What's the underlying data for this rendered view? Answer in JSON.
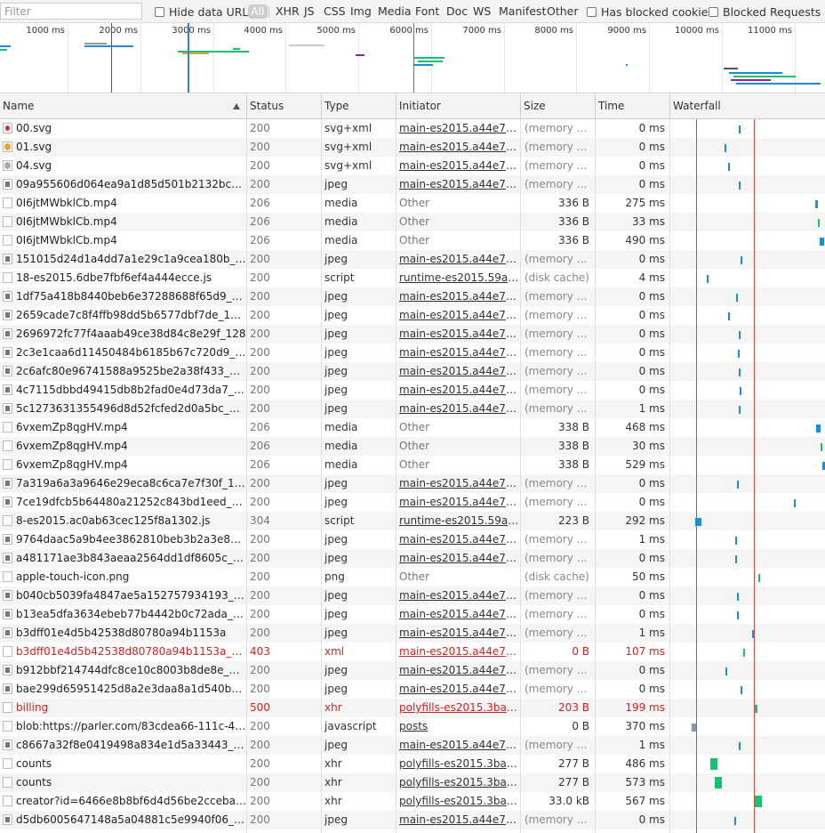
{
  "filter": {
    "placeholder": "Filter"
  },
  "toolbar": {
    "hide_data_urls": "Hide data URLs",
    "types": [
      "All",
      "XHR",
      "JS",
      "CSS",
      "Img",
      "Media",
      "Font",
      "Doc",
      "WS",
      "Manifest",
      "Other"
    ],
    "has_blocked_cookies": "Has blocked cookies",
    "blocked_requests": "Blocked Requests"
  },
  "overview": {
    "ticks": [
      "1000 ms",
      "2000 ms",
      "3000 ms",
      "4000 ms",
      "5000 ms",
      "6000 ms",
      "7000 ms",
      "8000 ms",
      "9000 ms",
      "10000 ms",
      "11000 ms"
    ]
  },
  "columns": {
    "name": "Name",
    "status": "Status",
    "type": "Type",
    "initiator": "Initiator",
    "size": "Size",
    "time": "Time",
    "waterfall": "Waterfall"
  },
  "colors": {
    "blue_line": "#3b7bd6",
    "red_line": "#dd4444",
    "bar_blue": "#1f8dd6",
    "bar_green": "#18c16e",
    "error_text": "#d42222"
  },
  "rows": [
    {
      "name": "00.svg",
      "status": "200",
      "type": "svg+xml",
      "initiator": "main-es2015.a44e72b...",
      "size": "(memory ca...",
      "time": "0 ms",
      "icon": "red-icon"
    },
    {
      "name": "01.svg",
      "status": "200",
      "type": "svg+xml",
      "initiator": "main-es2015.a44e72b...",
      "size": "(memory ca...",
      "time": "0 ms",
      "icon": "orange-icon"
    },
    {
      "name": "04.svg",
      "status": "200",
      "type": "svg+xml",
      "initiator": "main-es2015.a44e72b...",
      "size": "(memory ca...",
      "time": "0 ms",
      "icon": "grey-icon"
    },
    {
      "name": "09a955606d064ea9a1d85d501b2132bc_128",
      "status": "200",
      "type": "jpeg",
      "initiator": "main-es2015.a44e72b...",
      "size": "(memory ca...",
      "time": "0 ms",
      "icon": "image-icon"
    },
    {
      "name": "0I6jtMWbklCb.mp4",
      "status": "206",
      "type": "media",
      "initiator": "Other",
      "size": "336 B",
      "time": "275 ms",
      "icon": "file-icon"
    },
    {
      "name": "0I6jtMWbklCb.mp4",
      "status": "206",
      "type": "media",
      "initiator": "Other",
      "size": "336 B",
      "time": "33 ms",
      "icon": "file-icon"
    },
    {
      "name": "0I6jtMWbklCb.mp4",
      "status": "206",
      "type": "media",
      "initiator": "Other",
      "size": "336 B",
      "time": "490 ms",
      "icon": "file-icon"
    },
    {
      "name": "151015d24d1a4dd7a1e29c1a9cea180b_128",
      "status": "200",
      "type": "jpeg",
      "initiator": "main-es2015.a44e72b...",
      "size": "(memory ca...",
      "time": "0 ms",
      "icon": "image-icon"
    },
    {
      "name": "18-es2015.6dbe7fbf6ef4a444ecce.js",
      "status": "200",
      "type": "script",
      "initiator": "runtime-es2015.59a2d...",
      "size": "(disk cache)",
      "time": "4 ms",
      "icon": "file-icon"
    },
    {
      "name": "1df75a418b8440beb6e37288688f65d9_128",
      "status": "200",
      "type": "jpeg",
      "initiator": "main-es2015.a44e72b...",
      "size": "(memory ca...",
      "time": "0 ms",
      "icon": "image-icon"
    },
    {
      "name": "2659cade7c8f4ffb98dd5b6577dbf7de_1200",
      "status": "200",
      "type": "jpeg",
      "initiator": "main-es2015.a44e72b...",
      "size": "(memory ca...",
      "time": "0 ms",
      "icon": "image-icon"
    },
    {
      "name": "2696972fc77f4aaab49ce38d84c8e29f_128",
      "status": "200",
      "type": "jpeg",
      "initiator": "main-es2015.a44e72b...",
      "size": "(memory ca...",
      "time": "0 ms",
      "icon": "image-icon"
    },
    {
      "name": "2c3e1caa6d11450484b6185b67c720d9_128",
      "status": "200",
      "type": "jpeg",
      "initiator": "main-es2015.a44e72b...",
      "size": "(memory ca...",
      "time": "0 ms",
      "icon": "image-icon"
    },
    {
      "name": "2c6afc80e96741588a9525be2a38f433_128",
      "status": "200",
      "type": "jpeg",
      "initiator": "main-es2015.a44e72b...",
      "size": "(memory ca...",
      "time": "0 ms",
      "icon": "image-icon"
    },
    {
      "name": "4c7115dbbd49415db8b2fad0e4d73da7_128",
      "status": "200",
      "type": "jpeg",
      "initiator": "main-es2015.a44e72b...",
      "size": "(memory ca...",
      "time": "0 ms",
      "icon": "image-icon"
    },
    {
      "name": "5c1273631355496d8d52fcfed2d0a5bc_128",
      "status": "200",
      "type": "jpeg",
      "initiator": "main-es2015.a44e72b...",
      "size": "(memory ca...",
      "time": "1 ms",
      "icon": "image-icon"
    },
    {
      "name": "6vxemZp8qgHV.mp4",
      "status": "206",
      "type": "media",
      "initiator": "Other",
      "size": "338 B",
      "time": "468 ms",
      "icon": "file-icon"
    },
    {
      "name": "6vxemZp8qgHV.mp4",
      "status": "206",
      "type": "media",
      "initiator": "Other",
      "size": "338 B",
      "time": "30 ms",
      "icon": "file-icon"
    },
    {
      "name": "6vxemZp8qgHV.mp4",
      "status": "206",
      "type": "media",
      "initiator": "Other",
      "size": "338 B",
      "time": "529 ms",
      "icon": "file-icon"
    },
    {
      "name": "7a319a6a3a9646e29eca8c6ca7e7f30f_128",
      "status": "200",
      "type": "jpeg",
      "initiator": "main-es2015.a44e72b...",
      "size": "(memory ca...",
      "time": "0 ms",
      "icon": "image-icon"
    },
    {
      "name": "7ce19dfcb5b64480a21252c843bd1eed_128",
      "status": "200",
      "type": "jpeg",
      "initiator": "main-es2015.a44e72b...",
      "size": "(memory ca...",
      "time": "0 ms",
      "icon": "image-icon"
    },
    {
      "name": "8-es2015.ac0ab63cec125f8a1302.js",
      "status": "304",
      "type": "script",
      "initiator": "runtime-es2015.59a2d...",
      "size": "223 B",
      "time": "292 ms",
      "icon": "file-icon"
    },
    {
      "name": "9764daac5a9b4ee3862810beb3b2a3e8_128",
      "status": "200",
      "type": "jpeg",
      "initiator": "main-es2015.a44e72b...",
      "size": "(memory ca...",
      "time": "1 ms",
      "icon": "image-icon"
    },
    {
      "name": "a481171ae3b843aeaa2564dd1df8605c_128",
      "status": "200",
      "type": "jpeg",
      "initiator": "main-es2015.a44e72b...",
      "size": "(memory ca...",
      "time": "0 ms",
      "icon": "image-icon"
    },
    {
      "name": "apple-touch-icon.png",
      "status": "200",
      "type": "png",
      "initiator": "Other",
      "size": "(disk cache)",
      "time": "50 ms",
      "icon": "file-icon"
    },
    {
      "name": "b040cb5039fa4847ae5a152757934193_128",
      "status": "200",
      "type": "jpeg",
      "initiator": "main-es2015.a44e72b...",
      "size": "(memory ca...",
      "time": "0 ms",
      "icon": "image-icon"
    },
    {
      "name": "b13ea5dfa3634ebeb77b4442b0c72ada_128",
      "status": "200",
      "type": "jpeg",
      "initiator": "main-es2015.a44e72b...",
      "size": "(memory ca...",
      "time": "0 ms",
      "icon": "image-icon"
    },
    {
      "name": "b3dff01e4d5b42538d80780a94b1153a",
      "status": "200",
      "type": "jpeg",
      "initiator": "main-es2015.a44e72b...",
      "size": "(memory ca...",
      "time": "1 ms",
      "icon": "image-icon"
    },
    {
      "name": "b3dff01e4d5b42538d80780a94b1153a_128",
      "status": "403",
      "type": "xml",
      "initiator": "main-es2015.a44e72b...",
      "size": "0 B",
      "time": "107 ms",
      "icon": "file-icon",
      "error": true
    },
    {
      "name": "b912bbf214744dfc8ce10c8003b8de8e_128",
      "status": "200",
      "type": "jpeg",
      "initiator": "main-es2015.a44e72b...",
      "size": "(memory ca...",
      "time": "0 ms",
      "icon": "image-icon"
    },
    {
      "name": "bae299d65951425d8a2e3daa8a1d540b_128",
      "status": "200",
      "type": "jpeg",
      "initiator": "main-es2015.a44e72b...",
      "size": "(memory ca...",
      "time": "0 ms",
      "icon": "image-icon"
    },
    {
      "name": "billing",
      "status": "500",
      "type": "xhr",
      "initiator": "polyfills-es2015.3bade...",
      "size": "203 B",
      "time": "199 ms",
      "icon": "file-icon",
      "error": true
    },
    {
      "name": "blob:https://parler.com/83cdea66-111c-4956-...",
      "status": "200",
      "type": "javascript",
      "initiator": "posts",
      "size": "0 B",
      "time": "370 ms",
      "icon": "file-icon"
    },
    {
      "name": "c8667a32f8e0419498a834e1d5a33443_128",
      "status": "200",
      "type": "jpeg",
      "initiator": "main-es2015.a44e72b...",
      "size": "(memory ca...",
      "time": "1 ms",
      "icon": "image-icon"
    },
    {
      "name": "counts",
      "status": "200",
      "type": "xhr",
      "initiator": "polyfills-es2015.3bade...",
      "size": "277 B",
      "time": "486 ms",
      "icon": "file-icon"
    },
    {
      "name": "counts",
      "status": "200",
      "type": "xhr",
      "initiator": "polyfills-es2015.3bade...",
      "size": "277 B",
      "time": "573 ms",
      "icon": "file-icon"
    },
    {
      "name": "creator?id=6466e8b8bf6d4d56be2cceba3ef2d...",
      "status": "200",
      "type": "xhr",
      "initiator": "polyfills-es2015.3bade...",
      "size": "33.0 kB",
      "time": "567 ms",
      "icon": "file-icon"
    },
    {
      "name": "d5db6005647148a5a04881c5e9940f06_128",
      "status": "200",
      "type": "jpeg",
      "initiator": "main-es2015.a44e72b...",
      "size": "(memory ca...",
      "time": "0 ms",
      "icon": "image-icon"
    }
  ]
}
